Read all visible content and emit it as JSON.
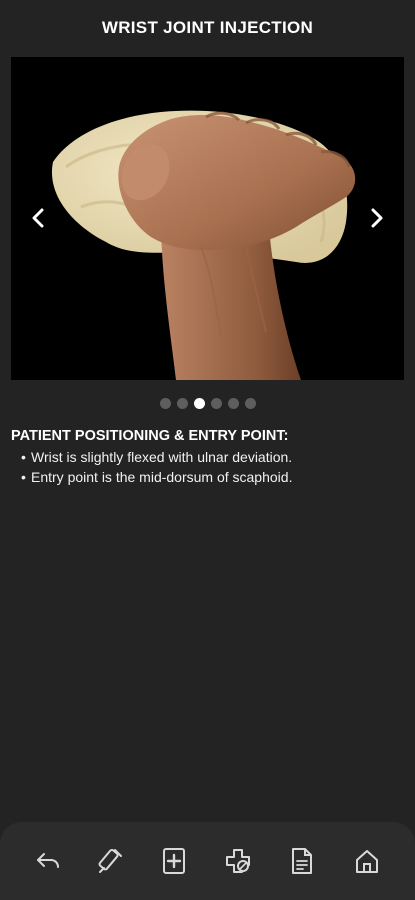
{
  "header": {
    "title": "WRIST JOINT INJECTION"
  },
  "carousel": {
    "image_alt": "Hand gripping a towel",
    "total_slides": 6,
    "active_slide": 3,
    "prev_icon": "chevron-left-icon",
    "next_icon": "chevron-right-icon"
  },
  "section": {
    "heading": "PATIENT POSITIONING & ENTRY POINT:",
    "bullets": [
      "Wrist is slightly flexed with ulnar deviation.",
      "Entry point is the mid-dorsum of scaphoid."
    ],
    "bullet_char": "•"
  },
  "bottom_nav": {
    "items": [
      {
        "icon": "back-arrow-icon"
      },
      {
        "icon": "syringe-icon"
      },
      {
        "icon": "medical-document-icon"
      },
      {
        "icon": "medicine-icon"
      },
      {
        "icon": "notes-document-icon"
      },
      {
        "icon": "home-icon"
      }
    ]
  },
  "colors": {
    "background": "#232323",
    "bar": "#2c2c2c",
    "dot_inactive": "#5e5e5e",
    "dot_active": "#ffffff",
    "icon": "#d9d9d9"
  }
}
